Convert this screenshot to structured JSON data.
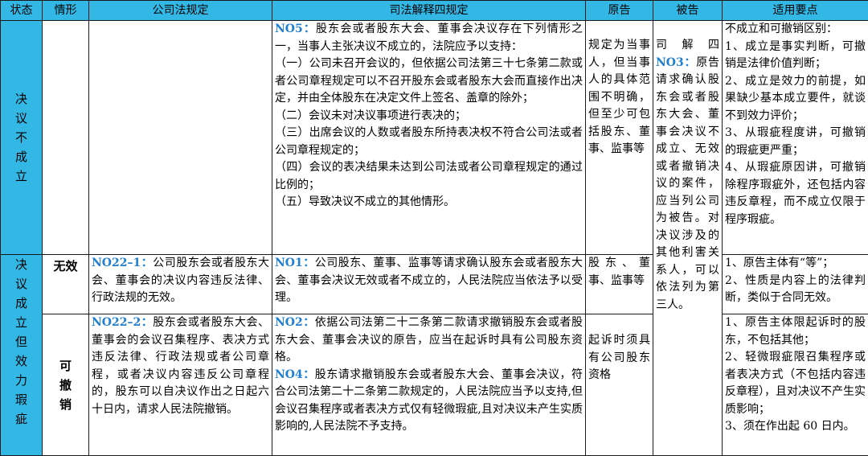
{
  "headers": [
    "状态",
    "情形",
    "公司法规定",
    "司法解释四规定",
    "原告",
    "被告",
    "适用要点"
  ],
  "rows": {
    "not_established": {
      "status": "决议不成立",
      "situation": "",
      "company_law": "",
      "judicial_interp": [
        {
          "no": "NO5：",
          "text": "股东会或者股东大会、董事会决议存在下列情形之一，当事人主张决议不成立的，法院应予以支持："
        },
        {
          "no": "",
          "text": "（一）公司未召开会议的，但依据公司法第三十七条第二款或者公司章程规定可以不召开股东会或者股东大会而直接作出决定，并由全体股东在决定文件上签名、盖章的除外；"
        },
        {
          "no": "",
          "text": "（二）会议未对决议事项进行表决的；"
        },
        {
          "no": "",
          "text": "（三）出席会议的人数或者股东所持表决权不符合公司法或者公司章程规定的；"
        },
        {
          "no": "",
          "text": "（四）会议的表决结果未达到公司法或者公司章程规定的通过比例的；"
        },
        {
          "no": "",
          "text": "（五）导致决议不成立的其他情形。"
        }
      ],
      "plaintiff": "规定为当事人，但当事人的具体范围不明确，但至少可包括股东、董事、监事等",
      "defendant_pre": "司解四",
      "defendant_no": "NO3：",
      "defendant_post": "原告请求确认股东会或者股东大会、董事会决议不成立、无效或者撤销决议的案件，应当列公司为被告。对决议涉及的其他利害关系人，可以依法列为第三人。",
      "points": "不成立和可撤销区别：\n1、成立是事实判断，可撤销是法律价值判断；\n2、成立是效力的前提，如果缺少基本成立要件，就谈不到效力评价；\n3、从瑕疵程度讲，可撤销的瑕疵更严重；\n4、从瑕疵原因讲，可撤销除程序瑕疵外，还包括内容违反章程，而不成立仅限于程序瑕疵。"
    },
    "defect_status": "决议成立但效力瑕疵",
    "invalid": {
      "situation": "无效",
      "company_law_no": "NO22–1：",
      "company_law_text": "公司股东会或者股东大会、董事会的决议内容违反法律、行政法规的无效。",
      "judicial_no": "NO1：",
      "judicial_text": "公司股东、董事、监事等请求确认股东会或者股东大会、董事会决议无效或者不成立的，人民法院应当依法予以受理。",
      "plaintiff": "股东、董事、监事等",
      "points": "1、原告主体有“等”；\n2、性质是内容上的法律判断，类似于合同无效。"
    },
    "revocable": {
      "situation": "可撤销",
      "company_law_no": "NO22–2：",
      "company_law_text": "股东会或者股东大会、董事会的会议召集程序、表决方式违反法律、行政法规或者公司章程，或者决议内容违反公司章程的，股东可以自决议作出之日起六十日内，请求人民法院撤销。",
      "judicial_no1": "NO2：",
      "judicial_text1": "依据公司法第二十二条第二款请求撤销股东会或者股东大会、董事会决议的原告，应当在起诉时具有公司股东资格。",
      "judicial_no2": "NO4：",
      "judicial_text2": "股东请求撤销股东会或者股东大会、董事会决议，符合公司法第二十二条第二款规定的，人民法院应当予以支持,但会议召集程序或者表决方式仅有轻微瑕疵,且对决议未产生实质影响的,人民法院不予支持。",
      "plaintiff": "起诉时须具有公司股东资格",
      "points": "1、原告主体限起诉时的股东，不包括其他；\n2、轻微瑕疵限召集程序或者表决方式（不包括内容违反章程），且对决议不产生实质影响；\n3、须在作出起 60 日内。"
    }
  },
  "colors": {
    "header_bg": "#33b8e6",
    "law_number": "#1f7fd0",
    "border": "#1a1a1a"
  }
}
